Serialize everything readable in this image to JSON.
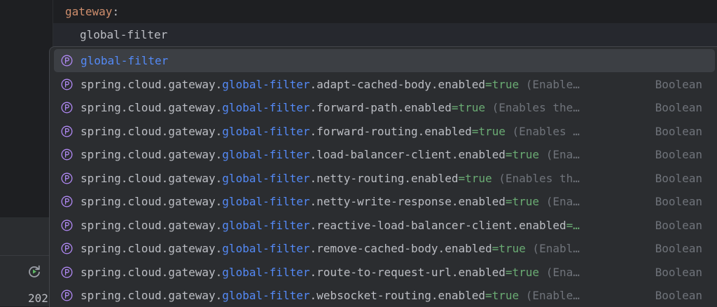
{
  "editor": {
    "key_line": {
      "key": "gateway",
      "colon": ":"
    },
    "typed_line": {
      "text": "global-filter"
    }
  },
  "bottom_panel": {
    "rerun_icon": "rerun-icon",
    "log_text": "202"
  },
  "completion": {
    "icon": "property-icon",
    "items": [
      {
        "prefix": "",
        "match": "global-filter",
        "suffix": "",
        "value": "",
        "hint": "",
        "type": ""
      },
      {
        "prefix": "spring.cloud.gateway.",
        "match": "global-filter",
        "suffix": ".adapt-cached-body.enabled",
        "value": "=true",
        "hint": " (Enable…",
        "type": "Boolean"
      },
      {
        "prefix": "spring.cloud.gateway.",
        "match": "global-filter",
        "suffix": ".forward-path.enabled",
        "value": "=true",
        "hint": " (Enables the…",
        "type": "Boolean"
      },
      {
        "prefix": "spring.cloud.gateway.",
        "match": "global-filter",
        "suffix": ".forward-routing.enabled",
        "value": "=true",
        "hint": " (Enables …",
        "type": "Boolean"
      },
      {
        "prefix": "spring.cloud.gateway.",
        "match": "global-filter",
        "suffix": ".load-balancer-client.enabled",
        "value": "=true",
        "hint": " (Ena…",
        "type": "Boolean"
      },
      {
        "prefix": "spring.cloud.gateway.",
        "match": "global-filter",
        "suffix": ".netty-routing.enabled",
        "value": "=true",
        "hint": " (Enables th…",
        "type": "Boolean"
      },
      {
        "prefix": "spring.cloud.gateway.",
        "match": "global-filter",
        "suffix": ".netty-write-response.enabled",
        "value": "=true",
        "hint": " (Ena…",
        "type": "Boolean"
      },
      {
        "prefix": "spring.cloud.gateway.",
        "match": "global-filter",
        "suffix": ".reactive-load-balancer-client.enabled",
        "value": "=…",
        "hint": "",
        "type": "Boolean"
      },
      {
        "prefix": "spring.cloud.gateway.",
        "match": "global-filter",
        "suffix": ".remove-cached-body.enabled",
        "value": "=true",
        "hint": " (Enabl…",
        "type": "Boolean"
      },
      {
        "prefix": "spring.cloud.gateway.",
        "match": "global-filter",
        "suffix": ".route-to-request-url.enabled",
        "value": "=true",
        "hint": " (Ena…",
        "type": "Boolean"
      },
      {
        "prefix": "spring.cloud.gateway.",
        "match": "global-filter",
        "suffix": ".websocket-routing.enabled",
        "value": "=true",
        "hint": " (Enable…",
        "type": "Boolean"
      }
    ]
  },
  "colors": {
    "editor_bg": "#1e1f22",
    "popup_bg": "#2b2d30",
    "selected_bg": "#3c3f44",
    "match_blue": "#548af7",
    "value_green": "#6aab73",
    "key_orange": "#cf8e6d",
    "muted_gray": "#6f737a",
    "property_icon_purple": "#b189f5"
  }
}
